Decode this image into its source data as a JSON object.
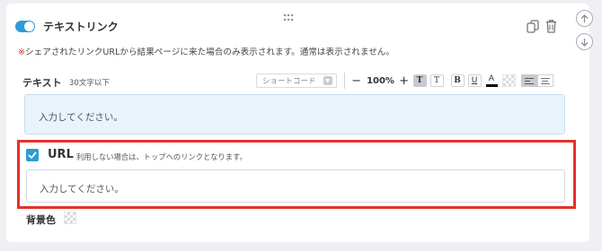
{
  "header": {
    "title": "テキストリンク",
    "toggle_on": true
  },
  "notice": {
    "mark": "※",
    "text": "シェアされたリンクURLから結果ページに来た場合のみ表示されます。通常は表示されません。"
  },
  "text_field": {
    "label": "テキスト",
    "sublabel": "30文字以下",
    "placeholder": "入力してください。"
  },
  "toolbar": {
    "shortcode_label": "ショートコード",
    "minus": "−",
    "zoom": "100%",
    "plus": "+",
    "t_fill": "T",
    "t_outline": "T",
    "bold": "B",
    "underline": "U",
    "font_color": "A"
  },
  "url_field": {
    "label": "URL",
    "checked": true,
    "note": "利用しない場合は、トップへのリンクとなります。",
    "placeholder": "入力してください。"
  },
  "background": {
    "label": "背景色"
  },
  "colors": {
    "accent": "#2e9bd6",
    "highlight_border": "#e7302a",
    "input_blue_bg": "#e9f3fc",
    "notice_mark": "#e0312a"
  },
  "icons": [
    "drag-handle-icon",
    "copy-icon",
    "trash-icon",
    "arrow-up-icon",
    "arrow-down-icon",
    "checkmark-icon"
  ]
}
